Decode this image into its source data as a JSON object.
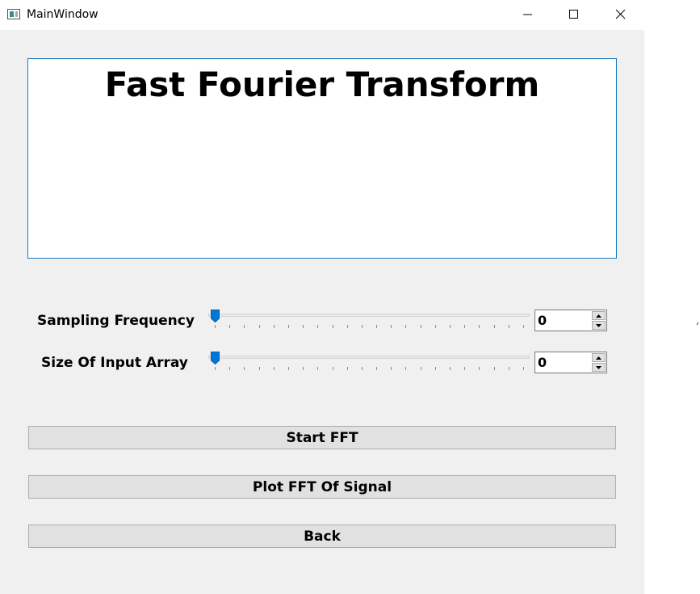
{
  "window": {
    "title": "MainWindow",
    "controls": {
      "minimize_icon": "minimize-icon",
      "maximize_icon": "maximize-icon",
      "close_icon": "close-icon"
    }
  },
  "heading": {
    "text": "Fast Fourier Transform"
  },
  "controls": {
    "sampling_frequency": {
      "label": "Sampling Frequency",
      "slider_value": 0,
      "spin_value": "0"
    },
    "input_array_size": {
      "label": "Size Of Input Array",
      "slider_value": 0,
      "spin_value": "0"
    }
  },
  "buttons": {
    "start_fft": "Start FFT",
    "plot_fft": "Plot FFT Of Signal",
    "back": "Back"
  },
  "colors": {
    "accent": "#0078d7",
    "frame_border": "#1a7fb8",
    "window_bg": "#f0f0f0",
    "button_bg": "#e1e1e1"
  }
}
